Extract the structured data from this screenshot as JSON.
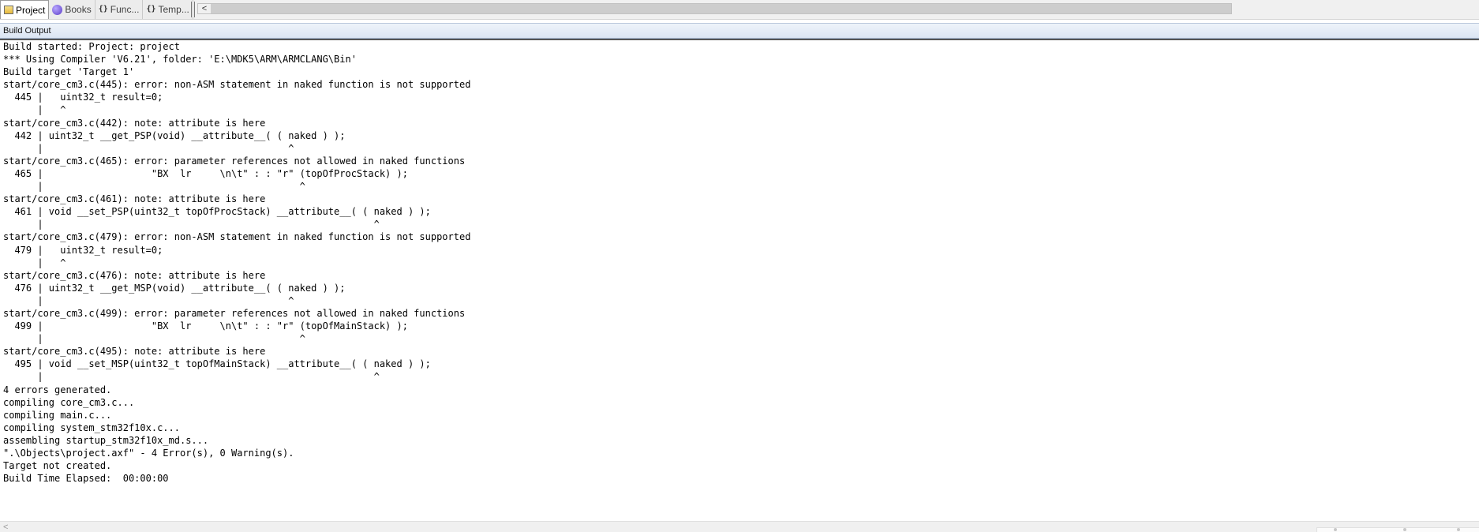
{
  "tabs": [
    {
      "label": "Project",
      "icon": "project-icon",
      "active": true
    },
    {
      "label": "Books",
      "icon": "books-icon",
      "active": false
    },
    {
      "label": "Func...",
      "icon": "functions-icon",
      "active": false
    },
    {
      "label": "Temp...",
      "icon": "templates-icon",
      "active": false
    }
  ],
  "tab_glyphs": {
    "functions": "{}",
    "templates": "{}"
  },
  "scrollbar": {
    "left_arrow": "<"
  },
  "panel": {
    "title": "Build Output"
  },
  "output": {
    "lines": [
      "Build started: Project: project",
      "*** Using Compiler 'V6.21', folder: 'E:\\MDK5\\ARM\\ARMCLANG\\Bin'",
      "Build target 'Target 1'",
      "start/core_cm3.c(445): error: non-ASM statement in naked function is not supported",
      "  445 |   uint32_t result=0;",
      "      |   ^",
      "start/core_cm3.c(442): note: attribute is here",
      "  442 | uint32_t __get_PSP(void) __attribute__( ( naked ) );",
      "      |                                           ^",
      "start/core_cm3.c(465): error: parameter references not allowed in naked functions",
      "  465 |                   \"BX  lr     \\n\\t\" : : \"r\" (topOfProcStack) );",
      "      |                                             ^",
      "start/core_cm3.c(461): note: attribute is here",
      "  461 | void __set_PSP(uint32_t topOfProcStack) __attribute__( ( naked ) );",
      "      |                                                          ^",
      "start/core_cm3.c(479): error: non-ASM statement in naked function is not supported",
      "  479 |   uint32_t result=0;",
      "      |   ^",
      "start/core_cm3.c(476): note: attribute is here",
      "  476 | uint32_t __get_MSP(void) __attribute__( ( naked ) );",
      "      |                                           ^",
      "start/core_cm3.c(499): error: parameter references not allowed in naked functions",
      "  499 |                   \"BX  lr     \\n\\t\" : : \"r\" (topOfMainStack) );",
      "      |                                             ^",
      "start/core_cm3.c(495): note: attribute is here",
      "  495 | void __set_MSP(uint32_t topOfMainStack) __attribute__( ( naked ) );",
      "      |                                                          ^",
      "4 errors generated.",
      "compiling core_cm3.c...",
      "compiling main.c...",
      "compiling system_stm32f10x.c...",
      "assembling startup_stm32f10x_md.s...",
      "\".\\Objects\\project.axf\" - 4 Error(s), 0 Warning(s).",
      "Target not created.",
      "Build Time Elapsed:  00:00:00"
    ]
  }
}
